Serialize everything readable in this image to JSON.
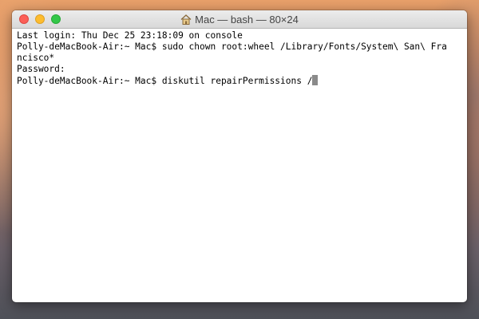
{
  "window": {
    "title": "Mac — bash — 80×24"
  },
  "icons": {
    "home": "home-icon",
    "close": "close-icon",
    "minimize": "minimize-icon",
    "zoom": "zoom-icon"
  },
  "colors": {
    "close": "#fc5f57",
    "minimize": "#fdbc2e",
    "zoom": "#33c748",
    "cursor": "#8a8a8a"
  },
  "terminal": {
    "lines": [
      "Last login: Thu Dec 25 23:18:09 on console",
      "Polly-deMacBook-Air:~ Mac$ sudo chown root:wheel /Library/Fonts/System\\ San\\ Fra",
      "ncisco*",
      "Password:",
      "Polly-deMacBook-Air:~ Mac$ diskutil repairPermissions /"
    ]
  }
}
